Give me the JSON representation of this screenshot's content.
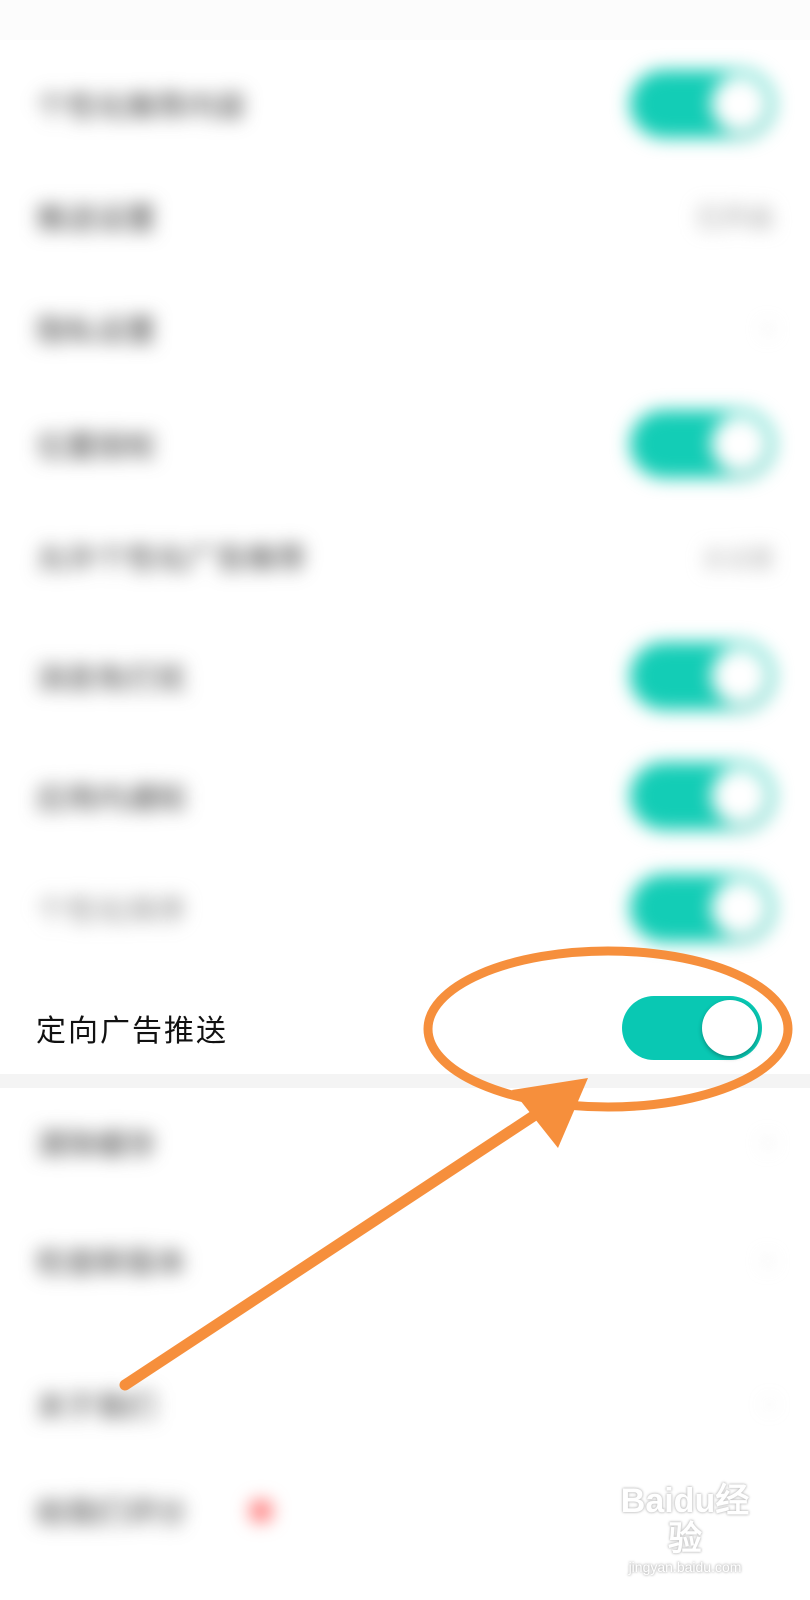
{
  "settings": {
    "items": [
      {
        "label": "个性化推荐内容",
        "control": "toggle",
        "on": true
      },
      {
        "label": "推送设置",
        "control": "value",
        "value": "已开启"
      },
      {
        "label": "隐私设置",
        "control": "chevron"
      },
      {
        "label": "位置授权",
        "control": "toggle",
        "on": true
      },
      {
        "label": "允许个性化广告推荐",
        "control": "value",
        "value": "去设置"
      },
      {
        "label": "消息免打扰",
        "control": "toggle",
        "on": true
      },
      {
        "label": "应用内通知",
        "control": "toggle",
        "on": true
      },
      {
        "label": "个性化排序",
        "control": "toggle",
        "on": true
      }
    ],
    "focused": {
      "label": "定向广告推送",
      "on": true
    },
    "lower_items": [
      {
        "label": "清除缓存"
      },
      {
        "label": "检查新版本"
      },
      {
        "label": "关于我们"
      },
      {
        "label": "给我们评分"
      }
    ]
  },
  "watermark": {
    "brand": "Baidu经验",
    "url": "jingyan.baidu.com"
  },
  "colors": {
    "accent": "#13cdb6",
    "annotation": "#f68f3c"
  }
}
